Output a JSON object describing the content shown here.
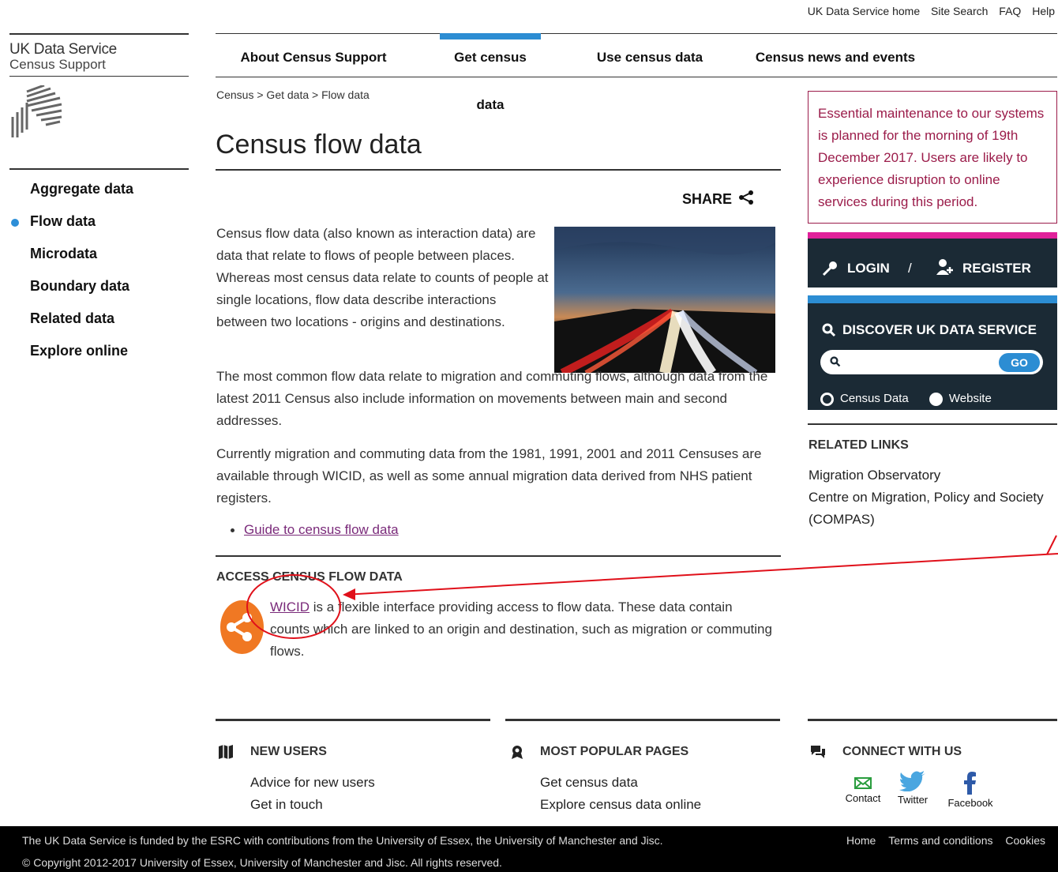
{
  "utility": [
    "UK Data Service home",
    "Site Search",
    "FAQ",
    "Help"
  ],
  "brand": {
    "name": "UK Data Service",
    "sub": "Census Support"
  },
  "leftnav": [
    "Aggregate data",
    "Flow data",
    "Microdata",
    "Boundary data",
    "Related data",
    "Explore online"
  ],
  "topnav": [
    "About Census Support",
    "Get census data",
    "Use census data",
    "Census news and events"
  ],
  "breadcrumb": "Census > Get data > Flow data",
  "page_title": "Census flow data",
  "share": "SHARE",
  "content": {
    "p1": "Census flow data (also known as interaction data) are data that relate to flows of people between places. Whereas most census data relate to counts of people at single locations, flow data describe interactions between two locations - origins and destinations.",
    "p2": "The most common flow data relate to migration and commuting flows, although data from the latest 2011 Census also include information on movements between main and second addresses.",
    "p3": "Currently migration and commuting data from the 1981, 1991, 2001 and 2011 Censuses are available through WICID, as well as some annual migration data derived from NHS patient registers.",
    "guide_link": "Guide to census flow data",
    "access_head": "ACCESS CENSUS FLOW DATA",
    "wicid_link": "WICID",
    "wicid_text": " is a flexible interface providing access to flow data. These data contain counts which are linked to an origin and destination, such as migration or commuting flows."
  },
  "notice": "Essential maintenance to our systems is planned for the morning of 19th December 2017. Users are likely to experience disruption to online services during this period.",
  "login": {
    "login": "LOGIN",
    "slash": "/",
    "register": "REGISTER"
  },
  "discover": {
    "title": "DISCOVER UK DATA SERVICE",
    "go": "GO",
    "opt1": "Census Data",
    "opt2": "Website"
  },
  "related": {
    "head": "RELATED LINKS",
    "link1": "Migration Observatory",
    "link2": "Centre on Migration, Policy and Society (COMPAS)"
  },
  "footer_cols": {
    "new_users": {
      "head": "NEW USERS",
      "links": [
        "Advice for new users",
        "Get in touch"
      ]
    },
    "popular": {
      "head": "MOST POPULAR PAGES",
      "links": [
        "Get census data",
        "Explore census data online"
      ]
    },
    "connect": {
      "head": "CONNECT WITH US",
      "contact": "Contact",
      "twitter": "Twitter",
      "facebook": "Facebook"
    }
  },
  "footer": {
    "line1": "The UK Data Service is funded by the ESRC with contributions from the University of Essex, the University of Manchester and Jisc.",
    "line2": "© Copyright 2012-2017 University of Essex, University of Manchester and Jisc. All rights reserved.",
    "links": [
      "Home",
      "Terms and conditions",
      "Cookies"
    ]
  },
  "colors": {
    "accent_blue": "#2c8dd3",
    "notice": "#9b1c4a",
    "login_pink": "#e0219a",
    "dark_panel": "#1b2a35",
    "orange": "#f07823",
    "annotation": "#e0101a"
  }
}
